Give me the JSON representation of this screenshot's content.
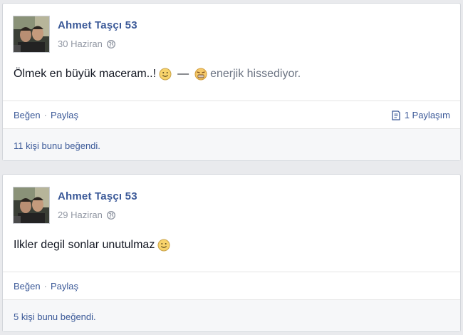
{
  "posts": [
    {
      "author": "Ahmet Taşçı 53",
      "date": "30 Haziran",
      "text": "Ölmek en büyük maceram..!",
      "separator": "—",
      "feeling": "enerjik hissediyor.",
      "actions": {
        "like": "Beğen",
        "dot": "·",
        "share": "Paylaş"
      },
      "share_count": "1 Paylaşım",
      "likes": "11 kişi bunu beğendi."
    },
    {
      "author": "Ahmet Taşçı 53",
      "date": "29 Haziran",
      "text": "Ilkler degil sonlar unutulmaz",
      "actions": {
        "like": "Beğen",
        "dot": "·",
        "share": "Paylaş"
      },
      "likes": "5 kişi bunu beğendi."
    }
  ],
  "icons": [
    "globe-icon",
    "smiley-icon",
    "energetic-emoji-icon",
    "share-count-icon"
  ],
  "colors": {
    "link": "#3b5998",
    "meta": "#9197a3",
    "background": "#e9eaed",
    "text": "#141823"
  }
}
